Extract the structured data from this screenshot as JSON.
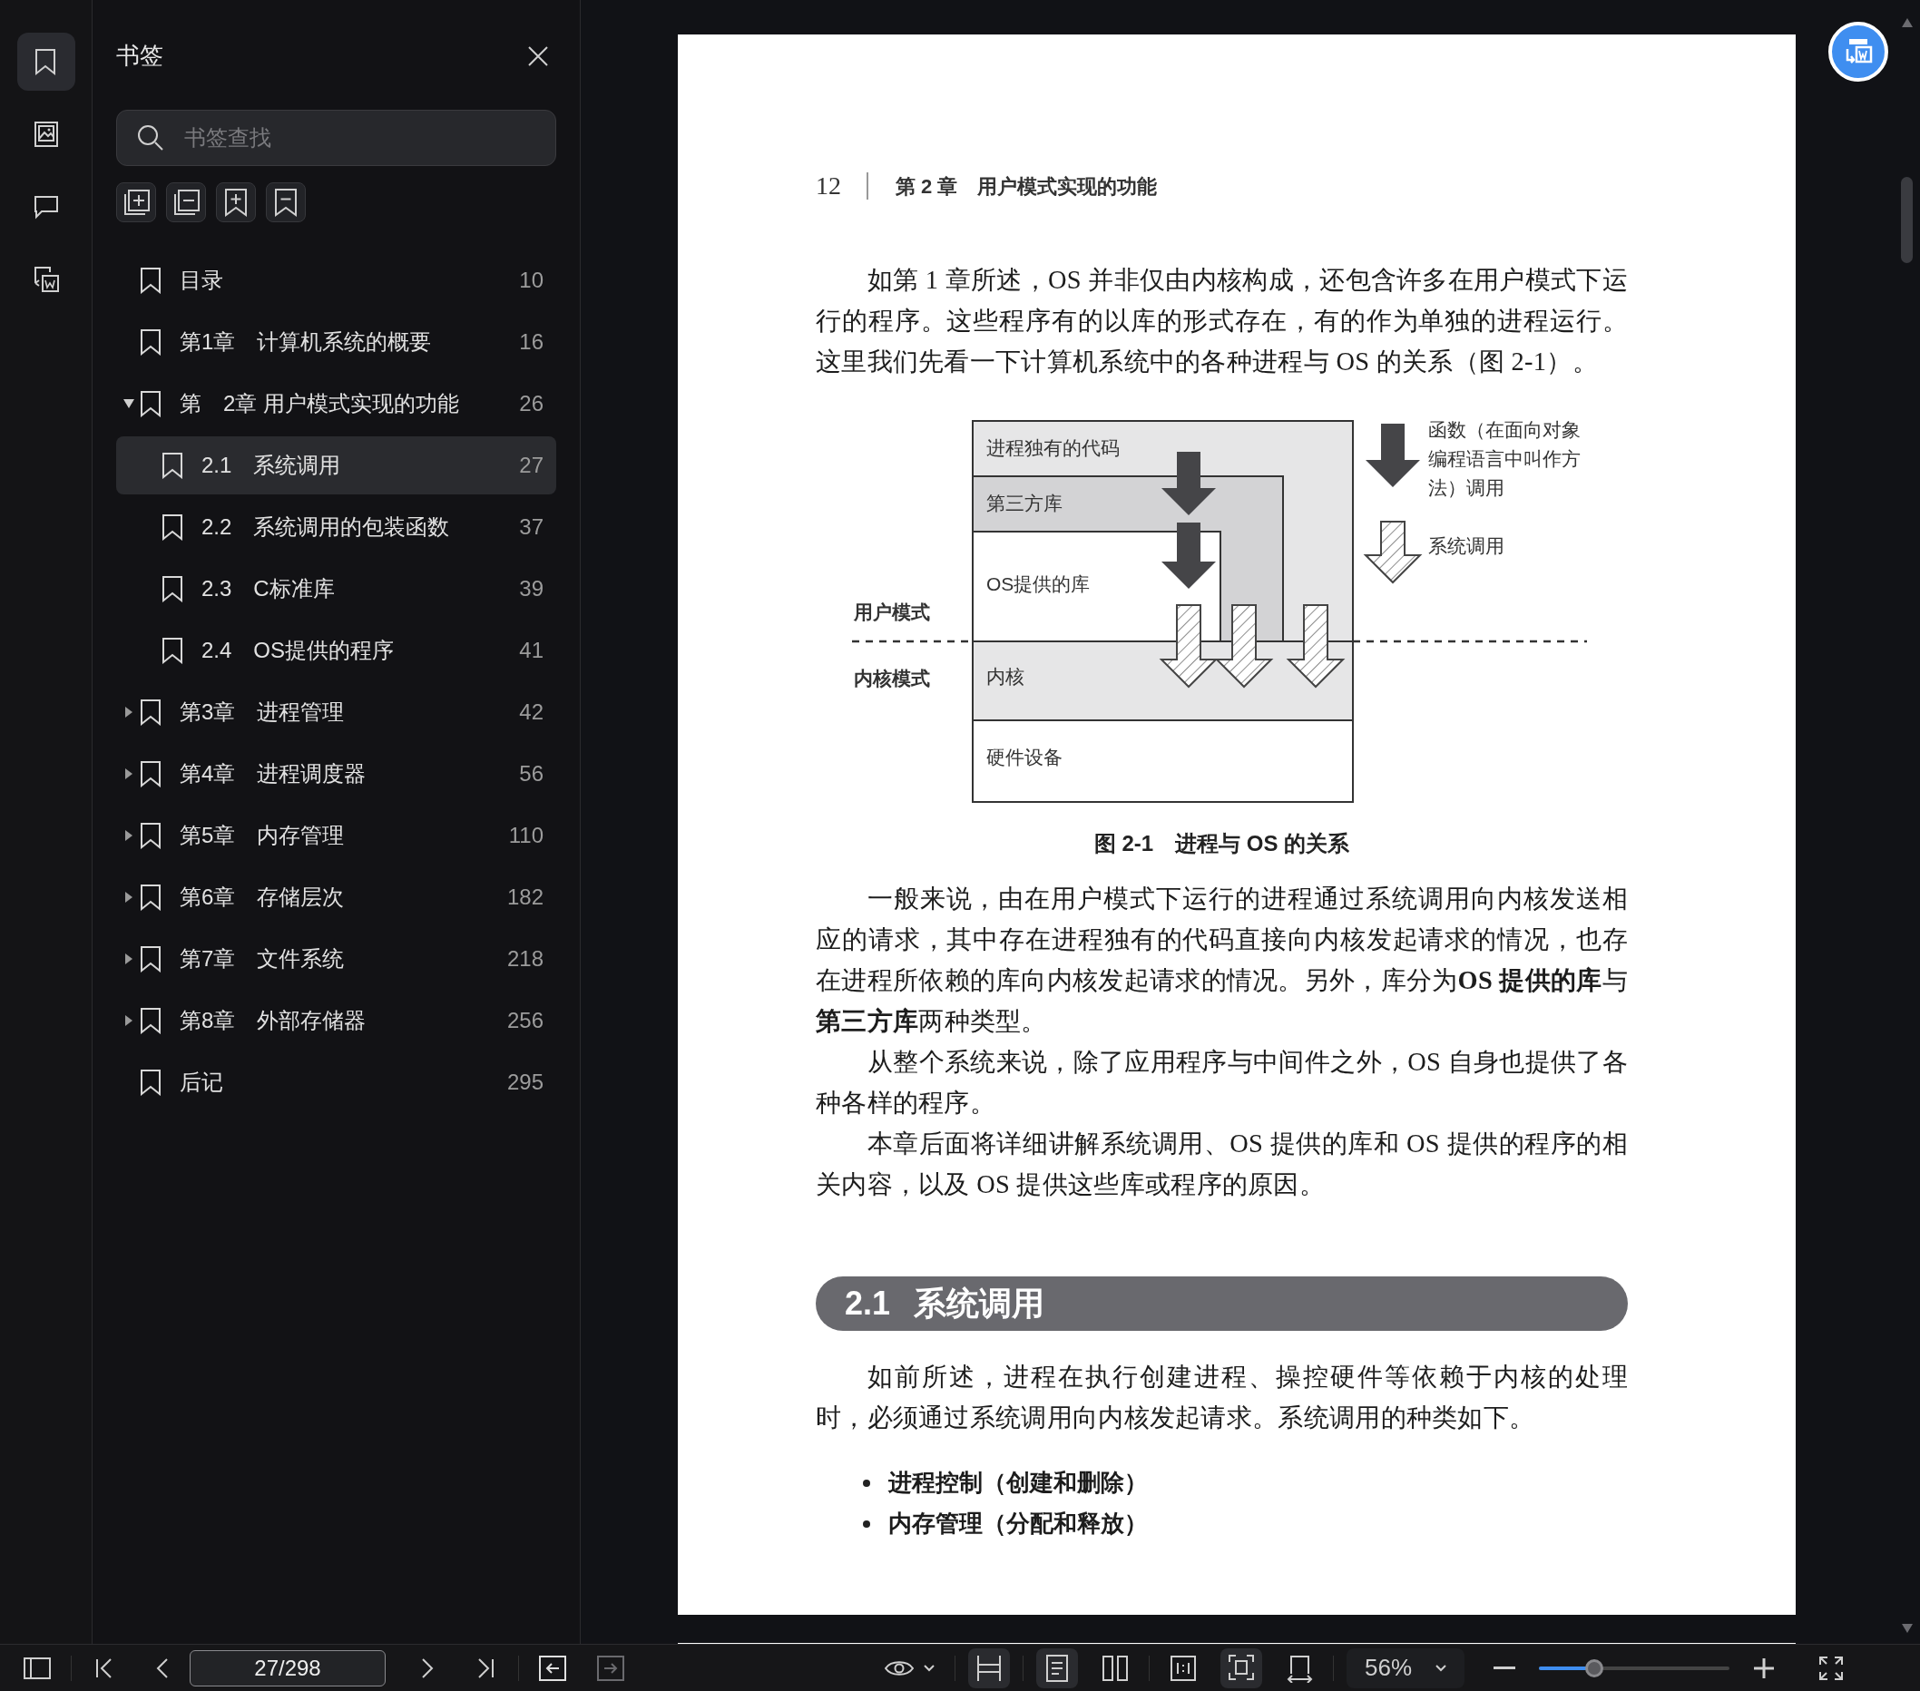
{
  "rail": [
    {
      "kind": "bookmarks",
      "selected": true
    },
    {
      "kind": "images",
      "selected": false
    },
    {
      "kind": "comments",
      "selected": false
    },
    {
      "kind": "convert",
      "selected": false
    }
  ],
  "sidebar": {
    "title": "书签",
    "search": {
      "placeholder": "书签查找"
    },
    "tools": [
      {
        "kind": "expand-all"
      },
      {
        "kind": "collapse-all"
      },
      {
        "kind": "add-bookmark"
      },
      {
        "kind": "remove-bookmark"
      }
    ],
    "items": [
      {
        "label": "目录",
        "page": "10",
        "selected": false
      },
      {
        "label": "第1章　计算机系统的概要",
        "page": "16",
        "selected": false
      },
      {
        "label": "第　2章 用户模式实现的功能",
        "page": "26",
        "selected": false,
        "expanded": true,
        "children": [
          {
            "label": "2.1　系统调用",
            "page": "27",
            "selected": true
          },
          {
            "label": "2.2　系统调用的包装函数",
            "page": "37",
            "selected": false
          },
          {
            "label": "2.3　C标准库",
            "page": "39",
            "selected": false
          },
          {
            "label": "2.4　OS提供的程序",
            "page": "41",
            "selected": false
          }
        ]
      },
      {
        "label": "第3章　进程管理",
        "page": "42",
        "selected": false,
        "expanded": false
      },
      {
        "label": "第4章　进程调度器",
        "page": "56",
        "selected": false,
        "expanded": false
      },
      {
        "label": "第5章　内存管理",
        "page": "110",
        "selected": false,
        "expanded": false
      },
      {
        "label": "第6章　存储层次",
        "page": "182",
        "selected": false,
        "expanded": false
      },
      {
        "label": "第7章　文件系统",
        "page": "218",
        "selected": false,
        "expanded": false
      },
      {
        "label": "第8章　外部存储器",
        "page": "256",
        "selected": false,
        "expanded": false
      },
      {
        "label": "后记",
        "page": "295",
        "selected": false
      }
    ]
  },
  "page": {
    "header": {
      "page_number": "12",
      "chapter": "第 2 章　用户模式实现的功能"
    },
    "blocks": [
      {
        "kind": "paragraph",
        "text": "如第 1 章所述，OS 并非仅由内核构成，还包含许多在用户模式下运行的程序。这些程序有的以库的形式存在，有的作为单独的进程运行。这里我们先看一下计算机系统中的各种进程与 OS 的关系（图 2-1）。"
      },
      {
        "kind": "figure",
        "rows": [
          "进程独有的代码",
          "第三方库",
          "OS提供的库",
          "内核",
          "硬件设备"
        ],
        "mode_labels": [
          "用户模式",
          "内核模式"
        ],
        "legend": [
          {
            "kind": "function-call",
            "text": "函数（在面向对象编程语言中叫作方法）调用"
          },
          {
            "kind": "system-call",
            "text": "系统调用"
          }
        ],
        "caption": "图 2-1　进程与 OS 的关系"
      },
      {
        "kind": "paragraph",
        "text": "一般来说，由在用户模式下运行的进程通过系统调用向内核发送相应的请求，其中存在进程独有的代码直接向内核发起请求的情况，也存在进程所依赖的库向内核发起请求的情况。另外，库分为**OS 提供的库**与**第三方库**两种类型。"
      },
      {
        "kind": "paragraph",
        "text": "从整个系统来说，除了应用程序与中间件之外，OS 自身也提供了各种各样的程序。"
      },
      {
        "kind": "paragraph",
        "text": "本章后面将详细讲解系统调用、OS 提供的库和 OS 提供的程序的相关内容，以及 OS 提供这些库或程序的原因。"
      },
      {
        "kind": "heading",
        "number": "2.1",
        "title": "系统调用"
      },
      {
        "kind": "paragraph",
        "text": "如前所述，进程在执行创建进程、操控硬件等依赖于内核的处理时，必须通过系统调用向内核发起请求。系统调用的种类如下。"
      },
      {
        "kind": "bullets",
        "items": [
          "进程控制（创建和删除）",
          "内存管理（分配和释放）"
        ]
      }
    ]
  },
  "toolbar": {
    "page_field": "27/298",
    "history": [
      {
        "kind": "back",
        "disabled": false
      },
      {
        "kind": "forward",
        "disabled": true
      }
    ],
    "view_buttons": [
      {
        "kind": "fit-width",
        "selected": true
      },
      {
        "kind": "single-page",
        "selected": true
      },
      {
        "kind": "two-page",
        "selected": false
      },
      {
        "kind": "actual-size",
        "selected": false
      },
      {
        "kind": "fit-page",
        "selected": true
      },
      {
        "kind": "rotate",
        "selected": false
      }
    ],
    "zoom": "56%",
    "zoom_slider": {
      "level": 0.29
    }
  }
}
